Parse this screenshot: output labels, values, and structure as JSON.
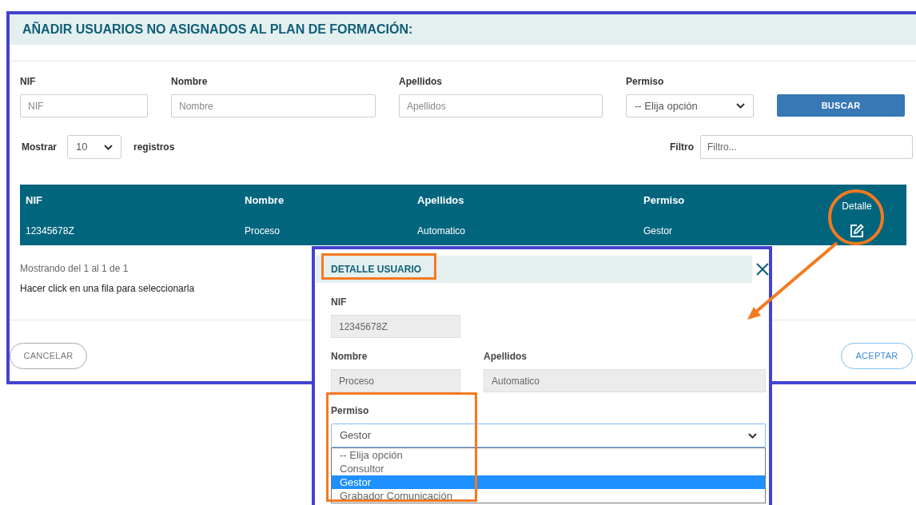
{
  "panel": {
    "title": "AÑADIR USUARIOS NO ASIGNADOS AL PLAN DE FORMACIÓN:",
    "filters": [
      {
        "label": "NIF",
        "kind": "input",
        "placeholder": "NIF"
      },
      {
        "label": "Nombre",
        "kind": "input",
        "placeholder": "Nombre"
      },
      {
        "label": "Apellidos",
        "kind": "input",
        "placeholder": "Apellidos"
      },
      {
        "label": "Permiso",
        "kind": "select",
        "value": "-- Elija opción"
      }
    ],
    "search_button": "BUSCAR",
    "page_size": {
      "label_before": "Mostrar",
      "value": "10",
      "label_after": "registros"
    },
    "filter": {
      "label": "Filtro",
      "placeholder": "Filtro..."
    },
    "table": {
      "columns": [
        "NIF",
        "Nombre",
        "Apellidos",
        "Permiso",
        "Detalle"
      ],
      "rows": [
        {
          "cells": [
            "12345678Z",
            "Proceso",
            "Automatico",
            "Gestor"
          ]
        }
      ]
    },
    "info": "Mostrando del 1 al 1 de 1",
    "hint": "Hacer click en una fila para seleccionarla",
    "cancel_button": "CANCELAR",
    "accept_button": "ACEPTAR"
  },
  "dialog": {
    "title": "DETALLE USUARIO",
    "fields": [
      {
        "label": "NIF",
        "value": "12345678Z"
      },
      {
        "label": "Nombre",
        "value": "Proceso"
      },
      {
        "label": "Apellidos",
        "value": "Automatico"
      }
    ],
    "permiso": {
      "label": "Permiso",
      "value": "Gestor",
      "options": [
        {
          "label": "-- Elija opción",
          "selected": false
        },
        {
          "label": "Consultor",
          "selected": false
        },
        {
          "label": "Gestor",
          "selected": true
        },
        {
          "label": "Grabador Comunicación",
          "selected": false
        }
      ]
    }
  }
}
